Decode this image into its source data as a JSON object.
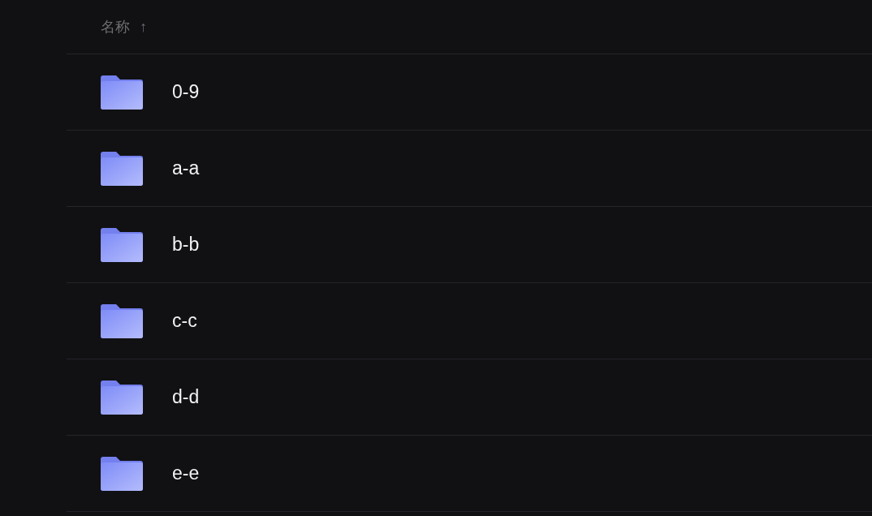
{
  "header": {
    "name_column": "名称",
    "sort_indicator": "↑"
  },
  "folders": [
    {
      "name": "0-9"
    },
    {
      "name": "a-a"
    },
    {
      "name": "b-b"
    },
    {
      "name": "c-c"
    },
    {
      "name": "d-d"
    },
    {
      "name": "e-e"
    }
  ]
}
